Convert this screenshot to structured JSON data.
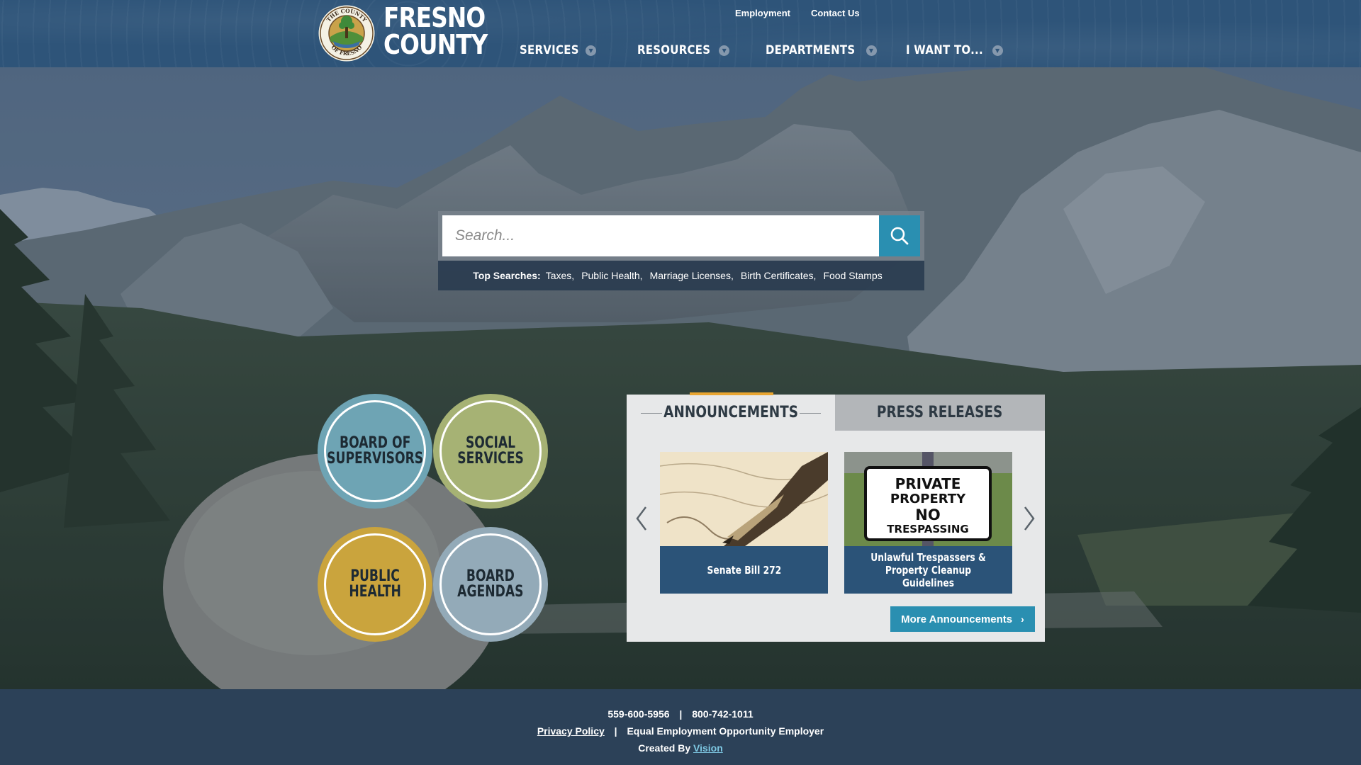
{
  "header": {
    "brand_line1": "FRESNO",
    "brand_line2": "COUNTY",
    "seal_text": "THE COUNTY OF FRESNO 1856",
    "utility_links": [
      "Employment",
      "Contact Us"
    ],
    "nav": [
      {
        "label": "SERVICES"
      },
      {
        "label": "RESOURCES"
      },
      {
        "label": "DEPARTMENTS"
      },
      {
        "label": "I WANT TO..."
      }
    ]
  },
  "search": {
    "placeholder": "Search...",
    "top_searches_label": "Top Searches:",
    "top_searches": [
      "Taxes,",
      "Public Health,",
      "Marriage Licenses,",
      "Birth Certificates,",
      "Food Stamps"
    ]
  },
  "quick_links": [
    {
      "label": "BOARD OF\nSUPERVISORS",
      "color": "#6ea4b4"
    },
    {
      "label": "SOCIAL\nSERVICES",
      "color": "#a6b274"
    },
    {
      "label": "PUBLIC\nHEALTH",
      "color": "#caa43d"
    },
    {
      "label": "BOARD\nAGENDAS",
      "color": "#93aab8"
    }
  ],
  "news": {
    "tabs": [
      "ANNOUNCEMENTS",
      "PRESS RELEASES"
    ],
    "active_tab": "ANNOUNCEMENTS",
    "cards": [
      {
        "caption": "Senate Bill 272"
      },
      {
        "caption": "Unlawful Trespassers &\nProperty Cleanup Guidelines",
        "sign_text": [
          "PRIVATE",
          "PROPERTY",
          "NO",
          "TRESPASSING"
        ]
      }
    ],
    "more_label": "More Announcements"
  },
  "footer": {
    "phone1": "559-600-5956",
    "phone2": "800-742-1011",
    "privacy": "Privacy Policy",
    "eeo": "Equal Employment Opportunity Employer",
    "created_by": "Created By",
    "vision": "Vision"
  },
  "colors": {
    "header_bg": "#2e5479",
    "accent_blue": "#2a8fb1",
    "accent_orange": "#e8a531",
    "footer_bg": "#2c4158",
    "card_caption_bg": "#2b5378"
  }
}
